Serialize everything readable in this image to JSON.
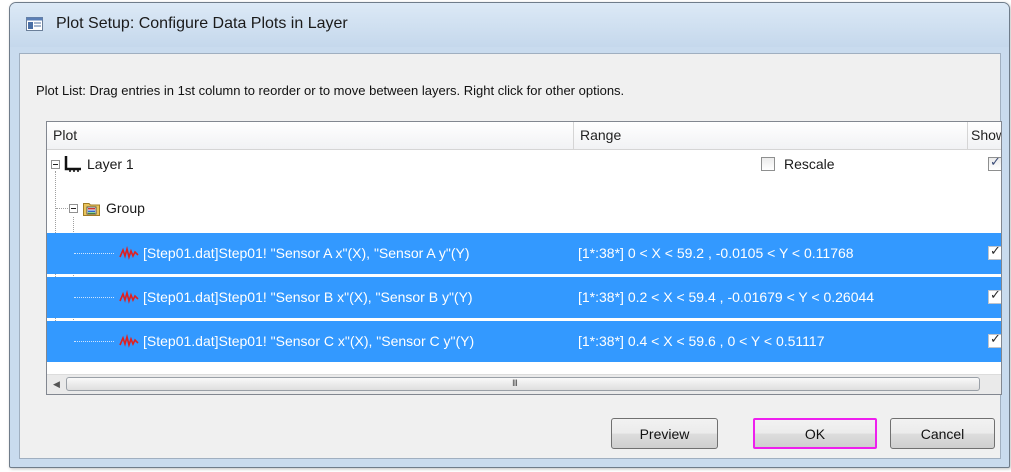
{
  "window": {
    "title": "Plot Setup: Configure Data Plots in Layer"
  },
  "instructions": "Plot List: Drag entries in 1st column to reorder or to move between layers. Right click for other options.",
  "plot_list": {
    "columns": [
      "Plot",
      "Range",
      "Show"
    ],
    "layer": {
      "label": "Layer 1",
      "rescale_label": "Rescale",
      "rescale_checked": false,
      "show_checked": true
    },
    "group": {
      "label": "Group"
    },
    "plots": [
      {
        "name": "[Step01.dat]Step01! \"Sensor A x\"(X), \"Sensor A y\"(Y)",
        "range": "[1*:38*]  0 < X < 59.2 , -0.0105 < Y < 0.11768",
        "show": true
      },
      {
        "name": "[Step01.dat]Step01! \"Sensor B x\"(X), \"Sensor B y\"(Y)",
        "range": "[1*:38*]  0.2 < X < 59.4 , -0.01679 < Y < 0.26044",
        "show": true
      },
      {
        "name": "[Step01.dat]Step01! \"Sensor C x\"(X), \"Sensor C y\"(Y)",
        "range": "[1*:38*]  0.4 < X < 59.6 , 0 < Y < 0.51117",
        "show": true
      }
    ],
    "scroll_grip": "III"
  },
  "buttons": {
    "preview": "Preview",
    "ok": "OK",
    "cancel": "Cancel"
  },
  "colors": {
    "selection": "#3399ff",
    "ok_highlight": "#ee1fee"
  }
}
